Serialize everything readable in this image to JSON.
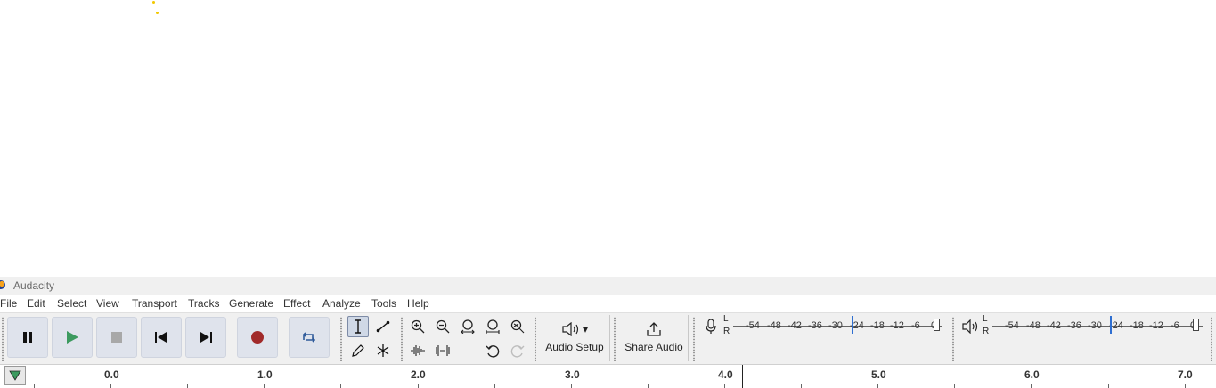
{
  "window": {
    "title": "Audacity"
  },
  "menu": [
    "File",
    "Edit",
    "Select",
    "View",
    "Transport",
    "Tracks",
    "Generate",
    "Effect",
    "Analyze",
    "Tools",
    "Help"
  ],
  "transport": {
    "pause": "pause-icon",
    "play": "play-icon",
    "stop": "stop-icon",
    "skip_start": "skip-to-start-icon",
    "skip_end": "skip-to-end-icon",
    "record": "record-icon",
    "loop": "loop-icon"
  },
  "audio_setup": {
    "label": "Audio Setup",
    "arrow": "▾"
  },
  "share_audio": {
    "label": "Share Audio"
  },
  "recording_meter": {
    "channel_l": "L",
    "channel_r": "R",
    "ticks": [
      "-54",
      "-48",
      "-42",
      "-36",
      "-30",
      "-24",
      "-18",
      "-12",
      "-6",
      "0"
    ]
  },
  "playback_meter": {
    "channel_l": "L",
    "channel_r": "R",
    "ticks": [
      "-54",
      "-48",
      "-42",
      "-36",
      "-30",
      "-24",
      "-18",
      "-12",
      "-6",
      "0"
    ]
  },
  "ruler": {
    "labels": [
      "0.0",
      "1.0",
      "2.0",
      "3.0",
      "4.0",
      "5.0",
      "6.0",
      "7.0"
    ]
  },
  "colors": {
    "accent": "#2f6fd1",
    "record": "#a12a2a",
    "play": "#3c9a5f",
    "toolbar_bg": "#f0f0f0",
    "button_bg": "#dfe3ec"
  }
}
